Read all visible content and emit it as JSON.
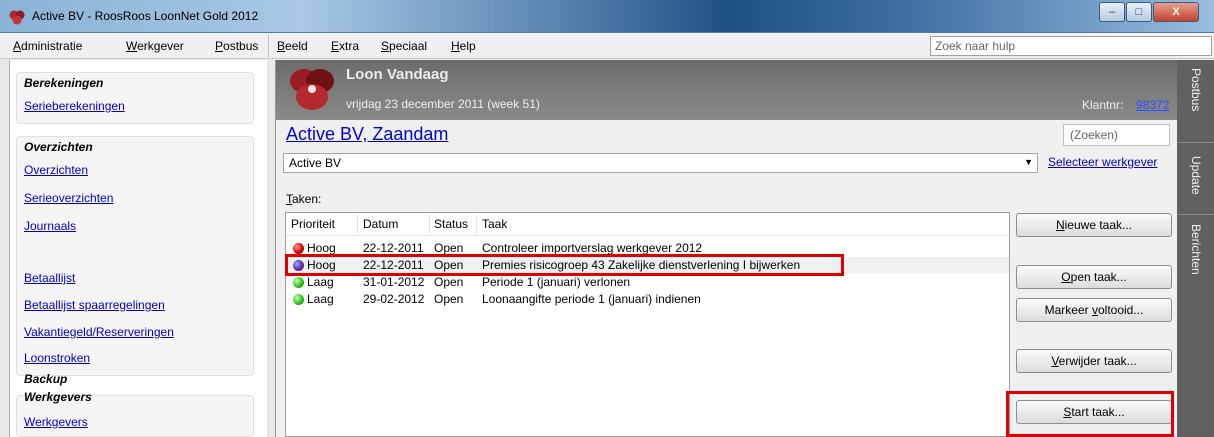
{
  "window": {
    "title": "Active BV - RoosRoos LoonNet Gold 2012",
    "close_glyph": "X",
    "min_glyph": "–",
    "max_glyph": "□"
  },
  "menu": {
    "items": [
      {
        "label": "Administratie",
        "acc": "A",
        "rest": "dministratie"
      },
      {
        "label": "Werkgever",
        "acc": "W",
        "rest": "erkgever"
      },
      {
        "label": "Postbus",
        "acc": "P",
        "rest": "ostbus"
      },
      {
        "label": "Beeld",
        "acc": "B",
        "rest": "eeld"
      },
      {
        "label": "Extra",
        "acc": "E",
        "rest": "xtra"
      },
      {
        "label": "Speciaal",
        "acc": "S",
        "rest": "peciaal"
      },
      {
        "label": "Help",
        "acc": "H",
        "rest": "elp"
      }
    ],
    "help_search_placeholder": "Zoek naar hulp"
  },
  "sidebar": {
    "groups": {
      "berekeningen": "Berekeningen",
      "overzichten": "Overzichten",
      "backup": "Backup",
      "werkgevers": "Werkgevers"
    },
    "links": {
      "serieberekeningen": "Serieberekeningen",
      "overzichten": "Overzichten",
      "serieoverzichten": "Serieoverzichten",
      "journaals": "Journaals",
      "betaallijst": "Betaallijst",
      "betaallijst_spaar": "Betaallijst spaarregelingen",
      "vakantiegeld": "Vakantiegeld/Reserveringen",
      "loonstroken": "Loonstroken",
      "werkgevers": "Werkgevers"
    }
  },
  "header": {
    "title": "Loon Vandaag",
    "date": "vrijdag 23 december 2011 (week 51)",
    "klant_label": "Klantnr:",
    "klant_number": "98372"
  },
  "company": {
    "name": "Active BV, Zaandam",
    "search_placeholder": "(Zoeken)",
    "selected_employer": "Active BV",
    "select_link": "Selecteer werkgever"
  },
  "tasks": {
    "label_acc": "T",
    "label_rest": "aken:",
    "columns": [
      "Prioriteit",
      "Datum",
      "Status",
      "Taak"
    ],
    "rows": [
      {
        "priority": "Hoog",
        "date": "22-12-2011",
        "status": "Open",
        "task": "Controleer importverslag werkgever 2012",
        "dot": "red"
      },
      {
        "priority": "Hoog",
        "date": "22-12-2011",
        "status": "Open",
        "task": "Premies risicogroep 43 Zakelijke dienstverlening I bijwerken",
        "dot": "mixed"
      },
      {
        "priority": "Laag",
        "date": "31-01-2012",
        "status": "Open",
        "task": "Periode 1 (januari) verlonen",
        "dot": "green"
      },
      {
        "priority": "Laag",
        "date": "29-02-2012",
        "status": "Open",
        "task": "Loonaangifte periode 1 (januari) indienen",
        "dot": "green"
      }
    ]
  },
  "actions": {
    "nieuwe": {
      "acc": "N",
      "rest": "ieuwe taak..."
    },
    "open": {
      "acc": "O",
      "rest": "pen taak..."
    },
    "markeer_pre": "Markeer ",
    "markeer_acc": "v",
    "markeer_rest": "oltooid...",
    "verwijder": {
      "acc": "V",
      "rest": "erwijder taak..."
    },
    "start": {
      "acc": "S",
      "rest": "tart taak..."
    }
  },
  "right_tabs": [
    "Postbus",
    "Update",
    "Berichten"
  ],
  "colors": {
    "highlight": "#e00000",
    "link": "#0000cc",
    "header_bg": "#7a7a7a"
  }
}
